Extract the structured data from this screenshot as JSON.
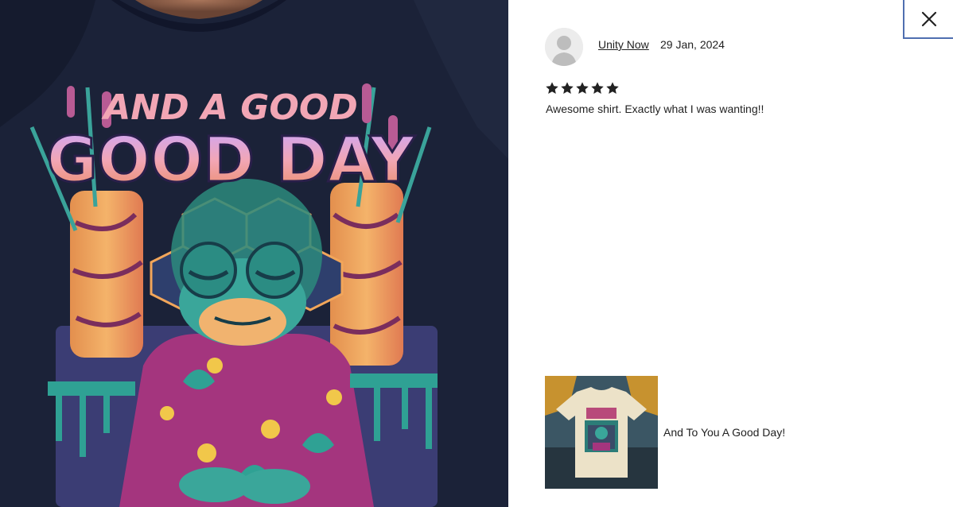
{
  "review": {
    "reviewer_name": "Unity Now",
    "date": "29 Jan, 2024",
    "rating": 5,
    "rating_max": 5,
    "text": "Awesome shirt. Exactly what I was wanting!!"
  },
  "product": {
    "title": "And To You A Good Day!"
  },
  "photo": {
    "shirt_text_top": "AND A GOOD",
    "shirt_text_main": "GOOD DAY"
  },
  "colors": {
    "shirt": "#1b2238",
    "accent_close_border": "#4f6fb0",
    "star": "#222222"
  }
}
